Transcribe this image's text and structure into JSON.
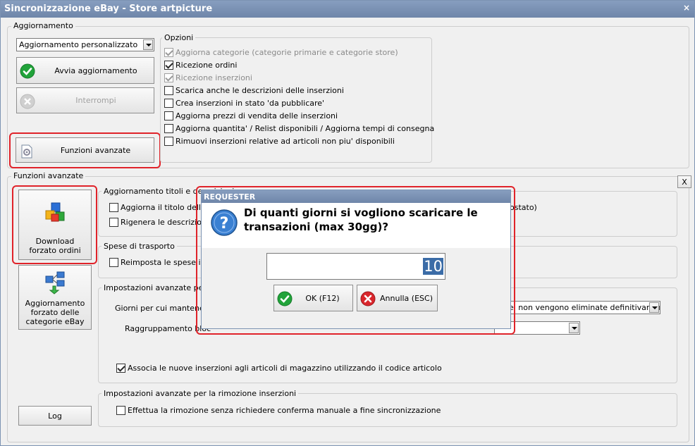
{
  "window": {
    "title": "Sincronizzazione eBay - Store artpicture",
    "close_symbol": "×"
  },
  "aggiornamento": {
    "legend": "Aggiornamento",
    "mode_value": "Aggiornamento personalizzato",
    "start_button": "Avvia aggiornamento",
    "stop_button": "Interrompi",
    "advanced_button": "Funzioni avanzate",
    "options_legend": "Opzioni",
    "options": [
      {
        "label": "Aggiorna categorie (categorie primarie e categorie store)",
        "checked": true,
        "disabled": true
      },
      {
        "label": "Ricezione ordini",
        "checked": true,
        "disabled": false
      },
      {
        "label": "Ricezione inserzioni",
        "checked": true,
        "disabled": true
      },
      {
        "label": "Scarica anche le descrizioni delle inserzioni",
        "checked": false,
        "disabled": false
      },
      {
        "label": "Crea inserzioni in stato 'da pubblicare'",
        "checked": false,
        "disabled": false
      },
      {
        "label": "Aggiorna prezzi di vendita delle inserzioni",
        "checked": false,
        "disabled": false
      },
      {
        "label": "Aggiorna quantita' / Relist disponibili / Aggiorna tempi di consegna",
        "checked": false,
        "disabled": false
      },
      {
        "label": "Rimuovi inserzioni relative ad articoli non piu' disponibili",
        "checked": false,
        "disabled": false
      }
    ]
  },
  "funzioni": {
    "legend": "Funzioni avanzate",
    "close_label": "X",
    "download_button": "Download forzato ordini",
    "categories_button": "Aggiornamento forzato delle categorie eBay",
    "log_button": "Log",
    "titoli_legend": "Aggiornamento titoli e descrizioni",
    "titoli_cb1": "Aggiorna il titolo delle ins",
    "titoli_cb1_tail": "ostato)",
    "titoli_cb2": "Rigenera le descrizioni d",
    "spese_legend": "Spese di trasporto",
    "spese_cb": "Reimposta le spese in ba",
    "impost_legend": "Impostazioni avanzate per a",
    "giorni_label": "Giorni per cui mantenere in",
    "giorni_select": "e' non vengono eliminate definitivamente",
    "raggr_label": "Raggruppamento bloc",
    "raggr_select": "",
    "associa_cb": "Associa le nuove inserzioni agli articoli di magazzino utilizzando il codice articolo",
    "rimoz_legend": "Impostazioni avanzate per la rimozione inserzioni",
    "rimoz_cb": "Effettua la rimozione senza richiedere conferma manuale a fine sincronizzazione"
  },
  "dialog": {
    "title": "REQUESTER",
    "question_line1": "Di quanti giorni si vogliono scaricare le",
    "question_line2": "transazioni (max 30gg)?",
    "value": "10",
    "ok_button": "OK (F12)",
    "cancel_button": "Annulla (ESC)"
  },
  "colors": {
    "titlebar": "#7a91b4",
    "highlight_red": "#e0232a",
    "ok_green": "#21a33a",
    "cancel_red": "#d9262c"
  }
}
